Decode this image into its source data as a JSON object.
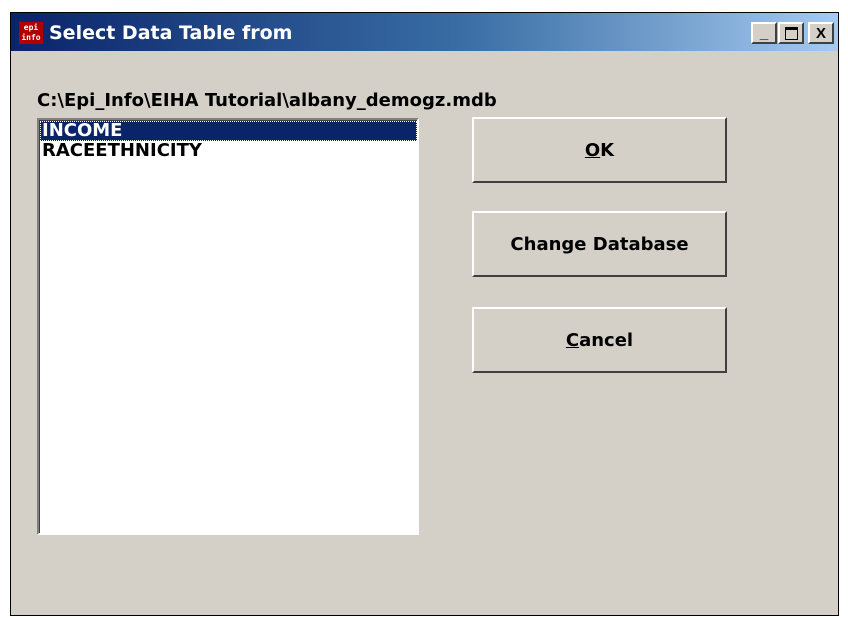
{
  "window": {
    "title": "Select Data Table from",
    "app_icon_text": "epi info",
    "minimize_label": "_",
    "maximize_label": "□",
    "close_label": "X"
  },
  "database_path": "C:\\Epi_Info\\EIHA Tutorial\\albany_demogz.mdb",
  "table_list": {
    "items": [
      {
        "label": "INCOME",
        "selected": true
      },
      {
        "label": "RACEETHNICITY",
        "selected": false
      }
    ]
  },
  "buttons": {
    "ok": {
      "accel": "O",
      "rest": "K"
    },
    "change_database": {
      "label": "Change Database"
    },
    "cancel": {
      "accel": "C",
      "rest": "ancel"
    }
  },
  "colors": {
    "titlebar_start": "#0a246a",
    "titlebar_end": "#a6caf0",
    "face": "#d4d0c8",
    "selection": "#0a246a"
  }
}
